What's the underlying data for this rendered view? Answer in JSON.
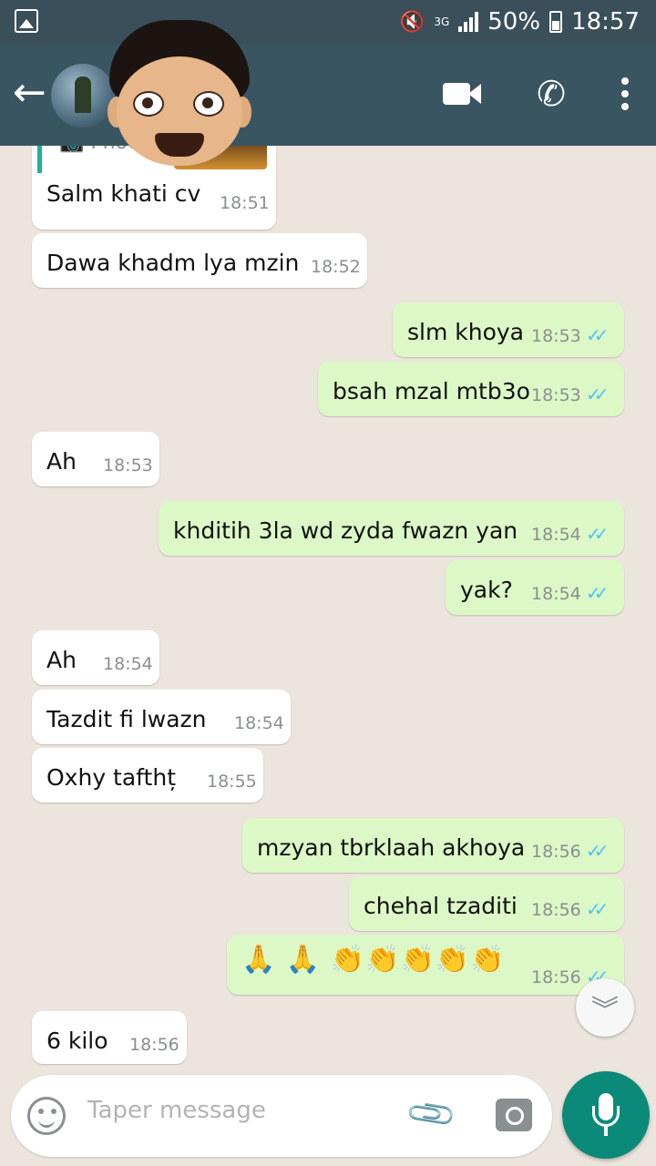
{
  "status_bar": {
    "network": "3G",
    "battery": "50%",
    "time": "18:57"
  },
  "header": {
    "back_icon": "arrow-left",
    "icons": [
      "video-call-icon",
      "voice-call-icon",
      "more-options-icon"
    ]
  },
  "messages": [
    {
      "dir": "in",
      "text": "Salm khati cv",
      "time": "18:51",
      "reply_label": "Photo"
    },
    {
      "dir": "in",
      "text": "Dawa khadm lya mzin",
      "time": "18:52"
    },
    {
      "dir": "out",
      "text": "slm khoya",
      "time": "18:53"
    },
    {
      "dir": "out",
      "text": "bsah mzal mtb3o",
      "time": "18:53"
    },
    {
      "dir": "in",
      "text": "Ah",
      "time": "18:53"
    },
    {
      "dir": "out",
      "text": "khditih 3la wd  zyda fwazn yan",
      "time": "18:54"
    },
    {
      "dir": "out",
      "text": "yak?",
      "time": "18:54"
    },
    {
      "dir": "in",
      "text": "Ah",
      "time": "18:54"
    },
    {
      "dir": "in",
      "text": "Tazdit fi lwazn",
      "time": "18:54"
    },
    {
      "dir": "in",
      "text": "Oxhy tafthț",
      "time": "18:55"
    },
    {
      "dir": "out",
      "text": "mzyan tbrklaah akhoya",
      "time": "18:56"
    },
    {
      "dir": "out",
      "text": "chehal tzaditi",
      "time": "18:56"
    },
    {
      "dir": "out",
      "text": "🙏 🙏 👏👏👏👏👏",
      "time": "18:56"
    },
    {
      "dir": "in",
      "text": "6 kilo",
      "time": "18:56"
    }
  ],
  "input": {
    "placeholder": "Taper message"
  },
  "colors": {
    "header": "#3a5562",
    "status_bar": "#3a4f5a",
    "incoming": "#ffffff",
    "outgoing": "#dcf8c6",
    "read_ticks": "#4fc3f7",
    "mic": "#0c8a79"
  }
}
